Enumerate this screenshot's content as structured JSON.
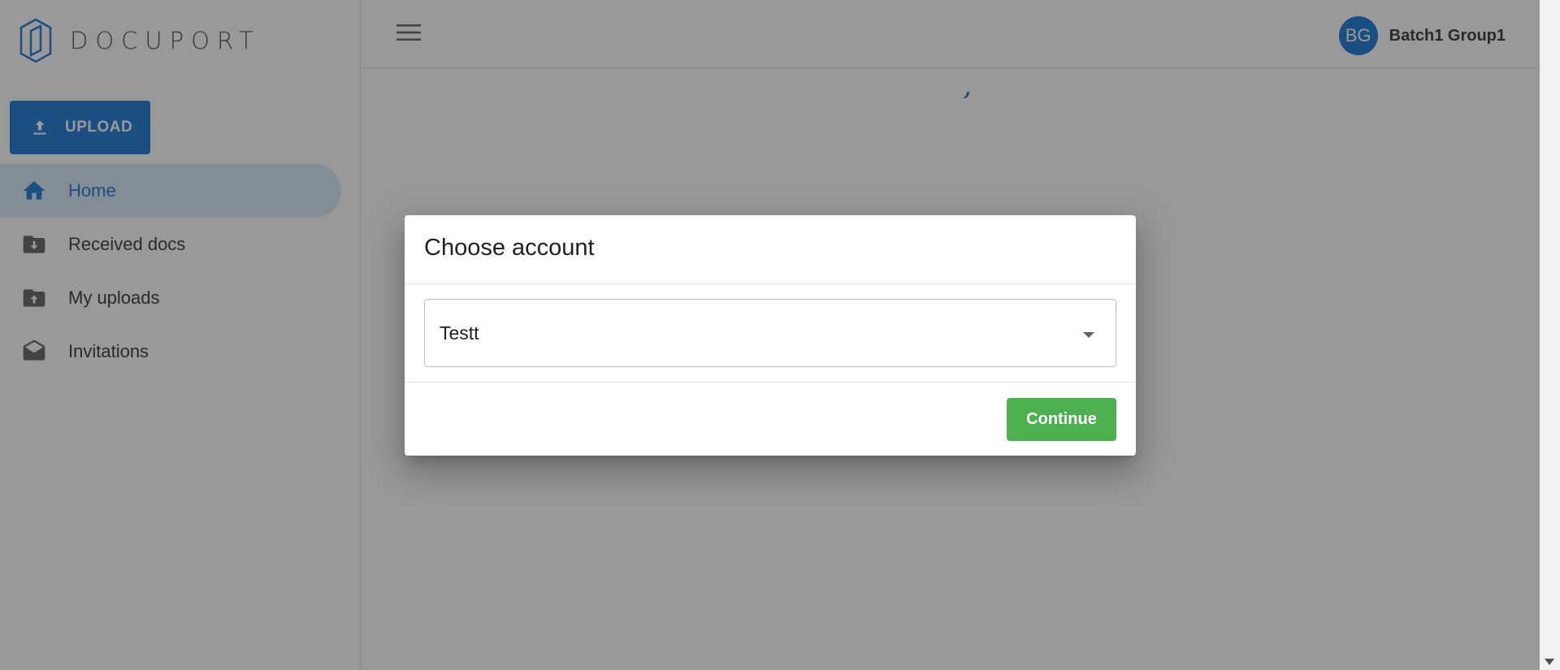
{
  "app": {
    "logo_text": "DOCUPORT"
  },
  "sidebar": {
    "upload_label": "UPLOAD",
    "items": [
      {
        "label": "Home",
        "icon": "home-icon",
        "active": true
      },
      {
        "label": "Received docs",
        "icon": "folder-download-icon",
        "active": false
      },
      {
        "label": "My uploads",
        "icon": "folder-upload-icon",
        "active": false
      },
      {
        "label": "Invitations",
        "icon": "envelope-open-icon",
        "active": false
      }
    ]
  },
  "header": {
    "avatar_initials": "BG",
    "user_name": "Batch1 Group1"
  },
  "dialog": {
    "title": "Choose account",
    "select_value": "Testt",
    "continue_label": "Continue"
  },
  "colors": {
    "primary": "#1976d2",
    "success": "#4caf50",
    "active_bg": "#d7e9f9"
  }
}
